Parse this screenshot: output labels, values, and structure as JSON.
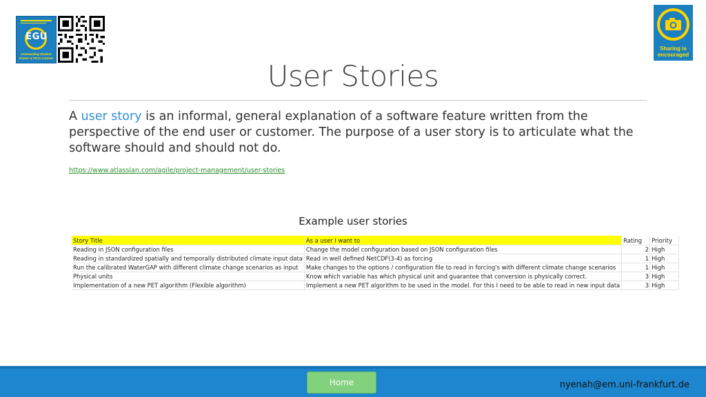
{
  "header": {
    "egu_badge": {
      "logo_text": "EGU",
      "caption_line1": "Outstanding Student",
      "caption_line2": "Poster & PICO Contest"
    },
    "share_badge": {
      "icon": "camera-icon",
      "label_line1": "Sharing is",
      "label_line2": "encouraged"
    }
  },
  "slide": {
    "title": "User Stories",
    "intro_prefix": "A ",
    "intro_highlight": "user story",
    "intro_rest": " is an informal, general explanation of a software feature written from the perspective of the end user or customer. The purpose of a user story is to articulate what the software should and should not do.",
    "reference_link": "https://www.atlassian.com/agile/project-management/user-stories",
    "example_heading": "Example user stories"
  },
  "table": {
    "headers": [
      "Story Title",
      "As a user I want to",
      "Rating",
      "Priority"
    ],
    "rows": [
      [
        "Reading in JSON configuration files",
        "Change the model configuration based on JSON configuration files",
        "2",
        "High"
      ],
      [
        "Reading in standardized spatially and temporally distributed climate input data",
        "Read in well defined NetCDF(3-4) as forcing",
        "1",
        "High"
      ],
      [
        "Run the calibrated WaterGAP with different climate change scenarios as input",
        "Make changes to the options / configuration file to read in forcing's with different climate change scenarios",
        "1",
        "High"
      ],
      [
        "Physical units",
        "Know which variable has which physical unit and guarantee that conversion is physically correct.",
        "3",
        "High"
      ],
      [
        "Implementation of a new PET algorithm (Flexible algorithm)",
        "Implement a new PET algorithm to be used in the model. For this I need to be able to read in new input data",
        "3",
        "High"
      ]
    ]
  },
  "footer": {
    "home_label": "Home",
    "email": "nyenah@em.uni-frankfurt.de"
  },
  "colors": {
    "brand_blue": "#1b7fc0",
    "badge_yellow": "#ffd200",
    "link_blue": "#2e8fd8",
    "header_highlight": "#ffff00",
    "home_green": "#82d17e"
  }
}
